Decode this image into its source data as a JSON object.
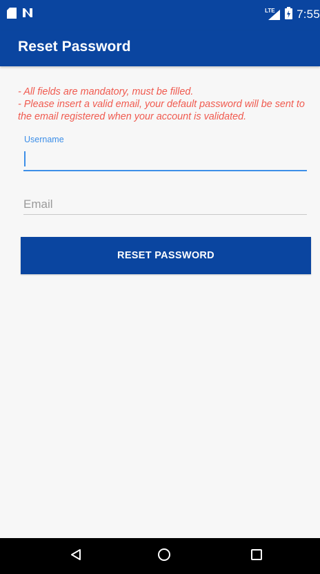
{
  "status_bar": {
    "time": "7:55",
    "network_label": "LTE",
    "icons": [
      "sd-card-icon",
      "n-notification-icon",
      "lte-signal-icon",
      "battery-icon"
    ]
  },
  "app_bar": {
    "title": "Reset Password"
  },
  "notes": {
    "line1": "- All fields are mandatory, must be filled.",
    "line2": "- Please insert a valid email, your default password will be sent to the email registered when your account is validated."
  },
  "form": {
    "username_label": "Username",
    "username_value": "",
    "email_placeholder": "Email",
    "email_value": "",
    "submit_label": "RESET PASSWORD"
  },
  "nav_bar": {
    "icons": [
      "back-icon",
      "home-icon",
      "recents-icon"
    ]
  },
  "colors": {
    "primary": "#0a45a0",
    "accent": "#3c8ee8",
    "error": "#f05a4f",
    "background": "#f7f7f7"
  }
}
